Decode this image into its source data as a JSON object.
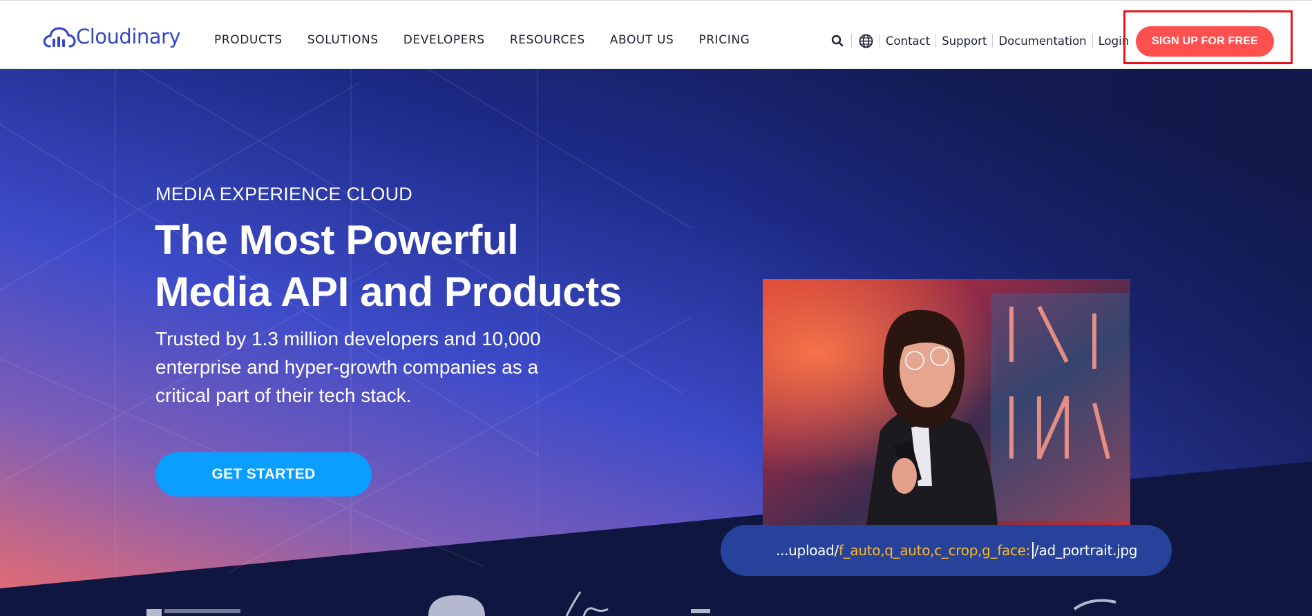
{
  "header": {
    "logo_text": "Cloudinary",
    "nav": [
      "PRODUCTS",
      "SOLUTIONS",
      "DEVELOPERS",
      "RESOURCES",
      "ABOUT US",
      "PRICING"
    ],
    "utility_links": [
      "Contact",
      "Support",
      "Documentation",
      "Login"
    ],
    "signup_label": "SIGN UP FOR FREE",
    "icons": [
      "search-icon",
      "globe-icon"
    ]
  },
  "hero": {
    "eyebrow": "MEDIA EXPERIENCE CLOUD",
    "headline_line1": "The Most Powerful",
    "headline_line2": "Media API and Products",
    "subtext": "Trusted by 1.3 million developers and 10,000 enterprise and hyper-growth companies as a critical part of their tech stack.",
    "cta_label": "GET STARTED",
    "url": {
      "prefix": "...upload/",
      "params": "f_auto,q_auto,c_crop,g_face:",
      "suffix": "/ad_portrait.jpg"
    }
  },
  "colors": {
    "brand_blue": "#3448c5",
    "signup_red": "#ff5050",
    "highlight_box": "#e8141b",
    "cta_blue": "#0a9eff",
    "hero_navy": "#0f1640",
    "url_highlight": "#ffb821"
  }
}
